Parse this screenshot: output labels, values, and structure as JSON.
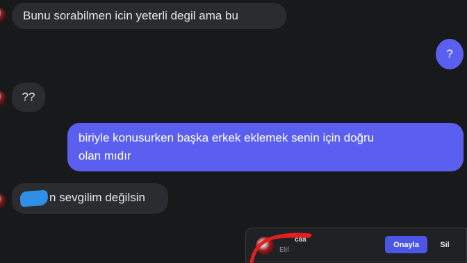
{
  "messages": [
    {
      "side": "in",
      "text": "Bunu sorabilmen icin yeterli degil ama bu"
    },
    {
      "side": "out",
      "text": "?"
    },
    {
      "side": "in",
      "text": "??"
    },
    {
      "side": "out",
      "line1": "biriyle konusurken başka erkek eklemek senin için doğru",
      "line2": "olan mıdır"
    },
    {
      "side": "in",
      "text": "n sevgilim değilsin"
    }
  ],
  "request": {
    "name": "caa",
    "subtitle": "Elif",
    "approve_label": "Onayla",
    "delete_label": "Sil"
  },
  "colors": {
    "background": "#18191b",
    "incoming_bubble": "#2b2c30",
    "outgoing_bubble": "#5a5ff0",
    "approve_button": "#4b55e6",
    "redaction_scribble": "#2f8fe6",
    "red_annotation": "#e02020"
  }
}
